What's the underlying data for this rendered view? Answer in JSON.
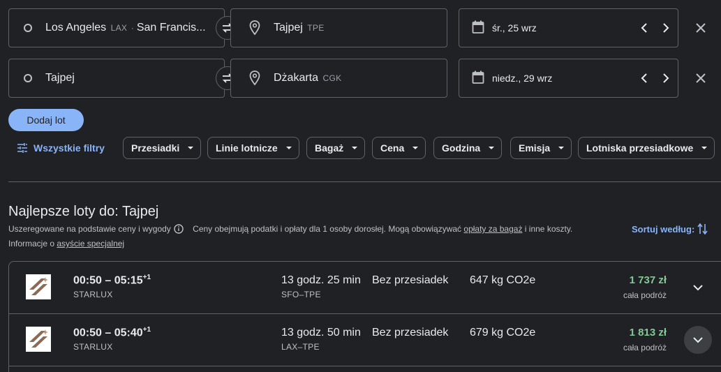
{
  "legs": [
    {
      "origin": {
        "city": "Los Angeles",
        "code": "LAX",
        "sep": " · ",
        "city2": "San Francis..."
      },
      "destination": {
        "city": "Tajpej",
        "code": "TPE"
      },
      "date": "śr., 25 wrz"
    },
    {
      "origin": {
        "city": "Tajpej",
        "code": "",
        "sep": "",
        "city2": ""
      },
      "destination": {
        "city": "Dżakarta",
        "code": "CGK"
      },
      "date": "niedz., 29 wrz"
    }
  ],
  "add_flight_label": "Dodaj lot",
  "all_filters_label": "Wszystkie filtry",
  "filters": [
    "Przesiadki",
    "Linie lotnicze",
    "Bagaż",
    "Cena",
    "Godzina",
    "Emisja",
    "Lotniska przesiadkowe"
  ],
  "results": {
    "title": "Najlepsze loty do: Tajpej",
    "ranking_note": "Uszeregowane na podstawie ceny i wygody",
    "price_note_prefix": "Ceny obejmują podatki i opłaty dla 1 osoby dorosłej. Mogą obowiązywać",
    "baggage_link": "opłaty za bagaż",
    "price_note_suffix": "i inne koszty.",
    "assist_prefix": "Informacje o",
    "assist_link": "asyście specjalnej",
    "sort_label": "Sortuj według:"
  },
  "flights": [
    {
      "time": "00:50 – 05:15",
      "plus": "+1",
      "airline": "STARLUX",
      "duration": "13 godz. 25 min",
      "route": "SFO–TPE",
      "stops": "Bez przesiadek",
      "co2": "647 kg CO2e",
      "price": "1 737 zł",
      "price_note": "cała podróż"
    },
    {
      "time": "00:50 – 05:40",
      "plus": "+1",
      "airline": "STARLUX",
      "duration": "13 godz. 50 min",
      "route": "LAX–TPE",
      "stops": "Bez przesiadek",
      "co2": "679 kg CO2e",
      "price": "1 813 zł",
      "price_note": "cała podróż"
    }
  ],
  "colors": {
    "accent": "#8ab4f8",
    "price": "#81c995",
    "background": "#202124",
    "border": "#5f6368"
  }
}
